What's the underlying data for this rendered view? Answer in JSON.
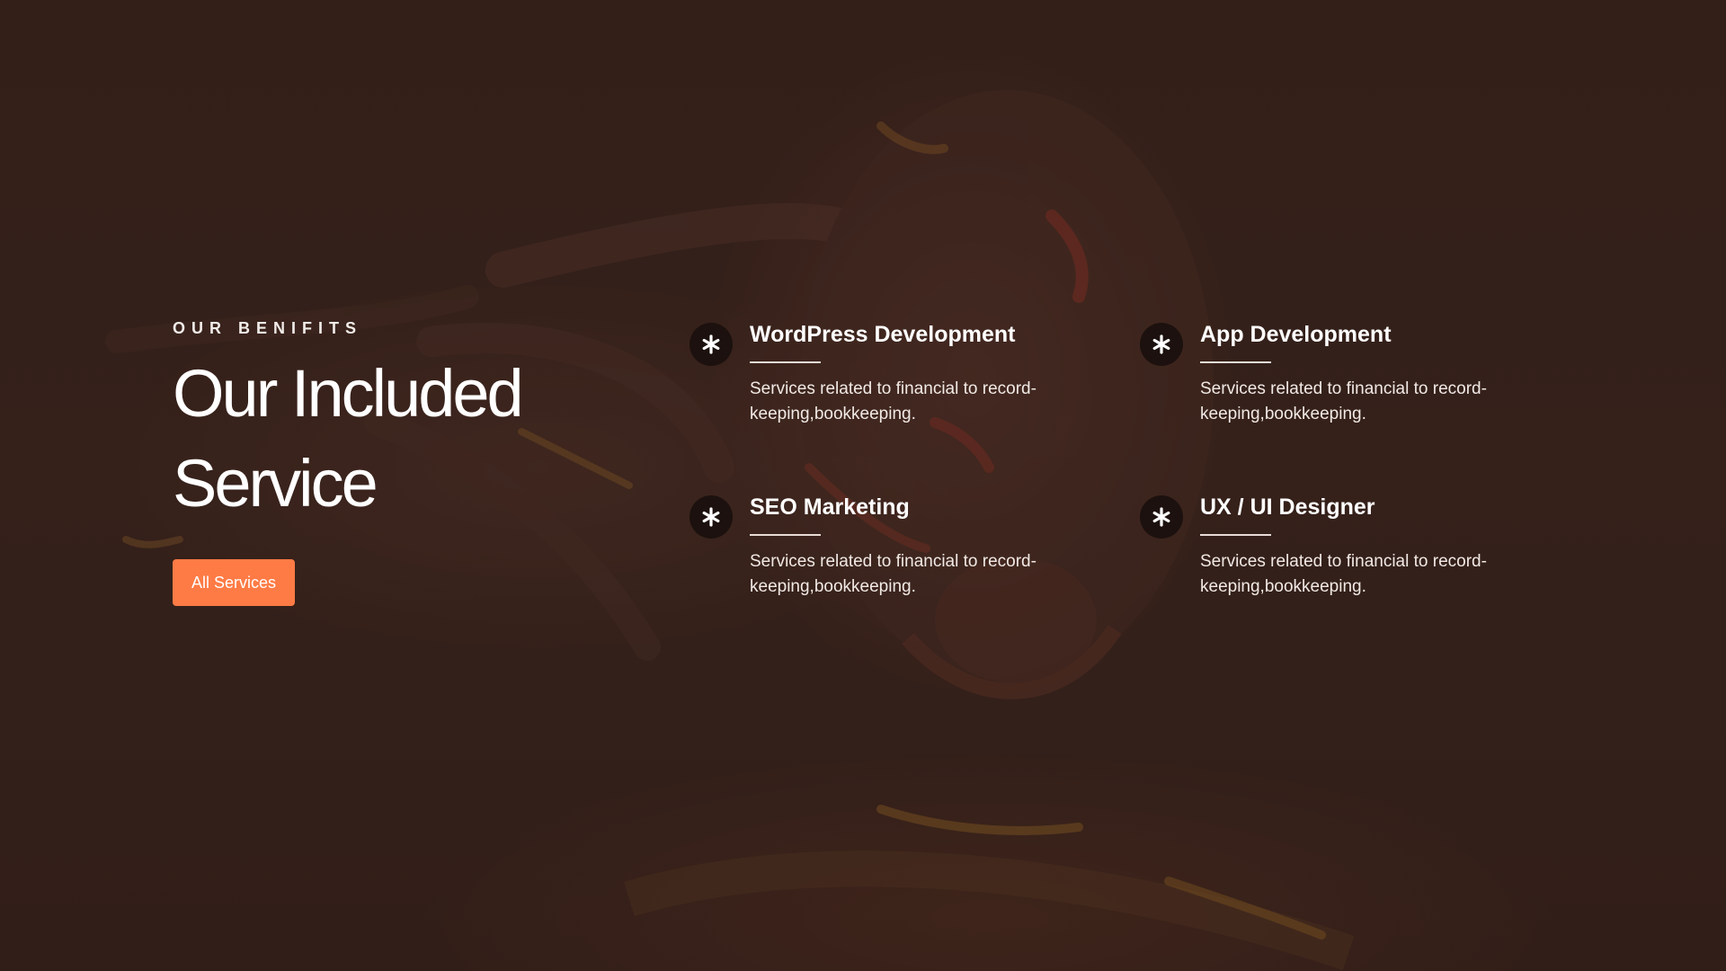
{
  "section": {
    "eyebrow": "OUR BENIFITS",
    "title_line1": "Our Included",
    "title_line2": "Service",
    "button_label": "All Services"
  },
  "services": [
    {
      "icon": "asterisk-icon",
      "title": "WordPress Development",
      "description": "Services related to financial to record-keeping,bookkeeping."
    },
    {
      "icon": "asterisk-icon",
      "title": "App Development",
      "description": "Services related to financial to record-keeping,bookkeeping."
    },
    {
      "icon": "asterisk-icon",
      "title": "SEO Marketing",
      "description": "Services related to financial to record-keeping,bookkeeping."
    },
    {
      "icon": "asterisk-icon",
      "title": "UX / UI Designer",
      "description": "Services related to financial to record-keeping,bookkeeping."
    }
  ],
  "colors": {
    "accent": "#ff7b45",
    "background": "#3a241e",
    "icon_circle": "#1c110e"
  }
}
